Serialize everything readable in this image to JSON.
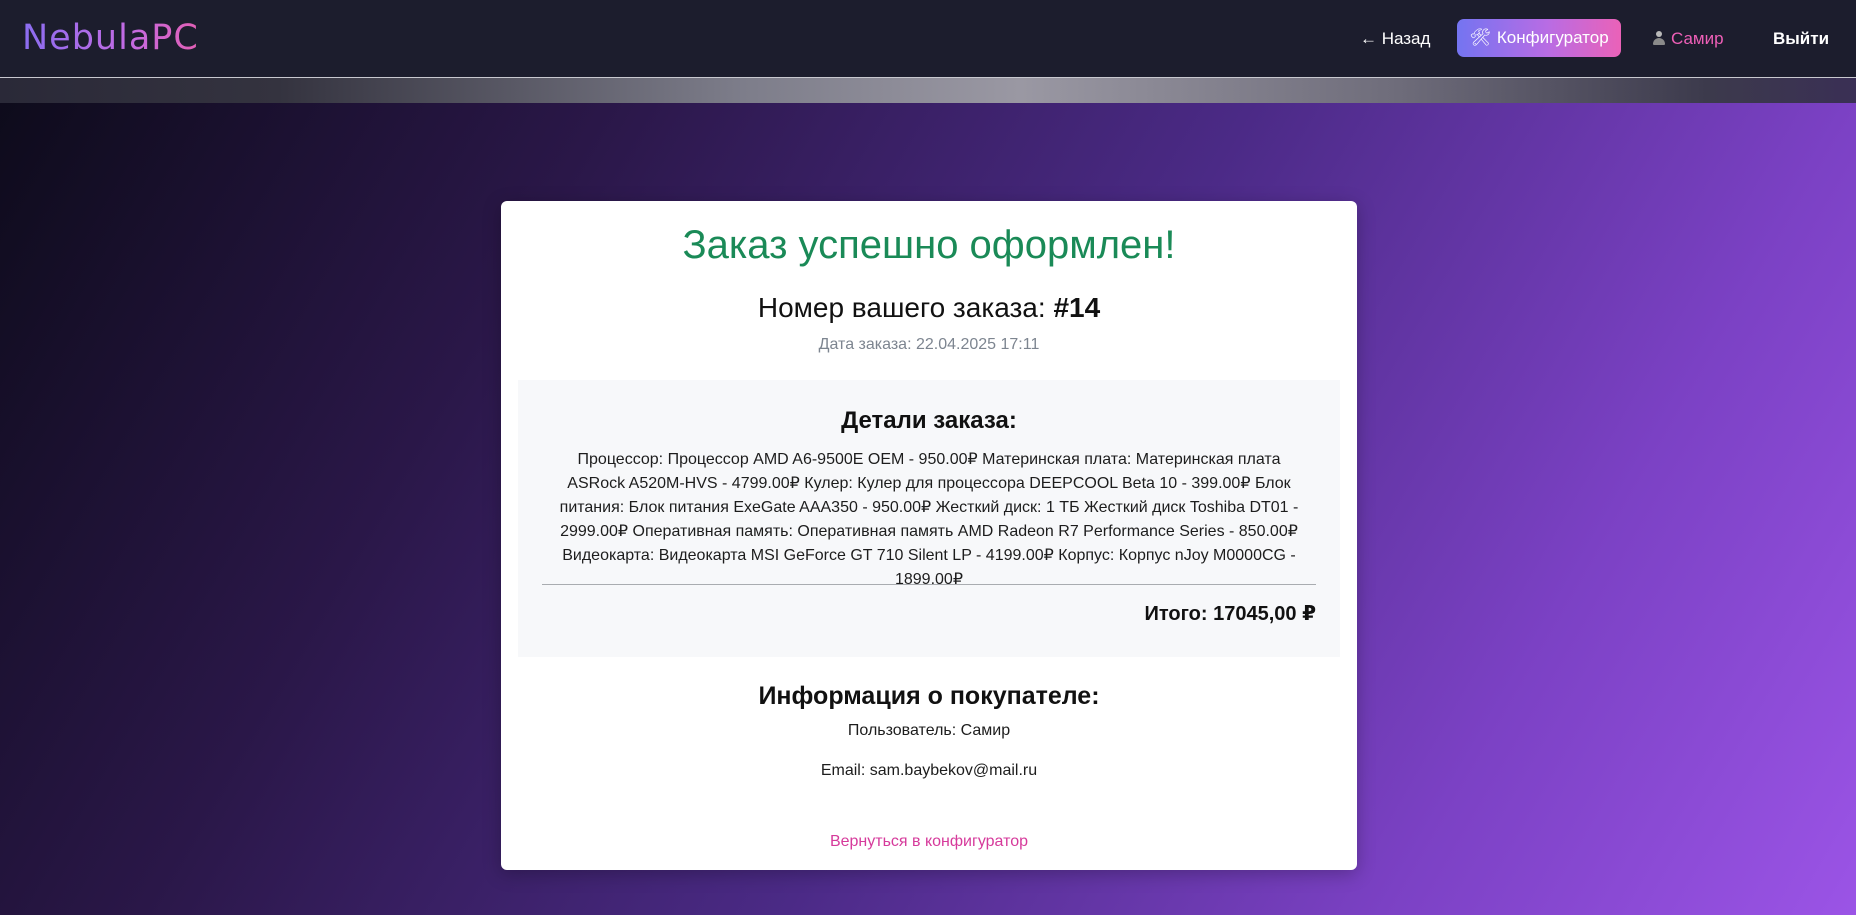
{
  "header": {
    "logo": "NebulaPC",
    "back_label": "← Назад",
    "configurator_icon": "hammer-wrench-icon",
    "configurator_label": "Конфигуратор",
    "user_icon": "user-icon",
    "user_label": "Самир",
    "logout_label": "Выйти"
  },
  "order": {
    "success_title": "Заказ успешно оформлен!",
    "number_label": "Номер вашего заказа:",
    "number_value": "#14",
    "date": "Дата заказа: 22.04.2025 17:11"
  },
  "details": {
    "title": "Детали заказа:",
    "text": "Процессор: Процессор AMD A6-9500E OEM - 950.00₽ Материнская плата: Материнская плата ASRock A520M-HVS - 4799.00₽ Кулер: Кулер для процессора DEEPCOOL Beta 10 - 399.00₽ Блок питания: Блок питания ExeGate AAA350 - 950.00₽ Жесткий диск: 1 ТБ Жесткий диск Toshiba DT01 - 2999.00₽ Оперативная память: Оперативная память AMD Radeon R7 Performance Series - 850.00₽ Видеокарта: Видеокарта MSI GeForce GT 710 Silent LP - 4199.00₽ Корпус: Корпус nJoy M0000CG - 1899.00₽",
    "total": "Итого: 17045,00 ₽"
  },
  "buyer": {
    "title": "Информация о покупателе:",
    "user": "Пользователь: Самир",
    "email": "Email: sam.baybekov@mail.ru"
  },
  "back_link": "Вернуться в конфигуратор",
  "colors": {
    "success": "#1a8a57",
    "accent_pink": "#d63a9b",
    "header_bg": "#1c1d2d"
  }
}
